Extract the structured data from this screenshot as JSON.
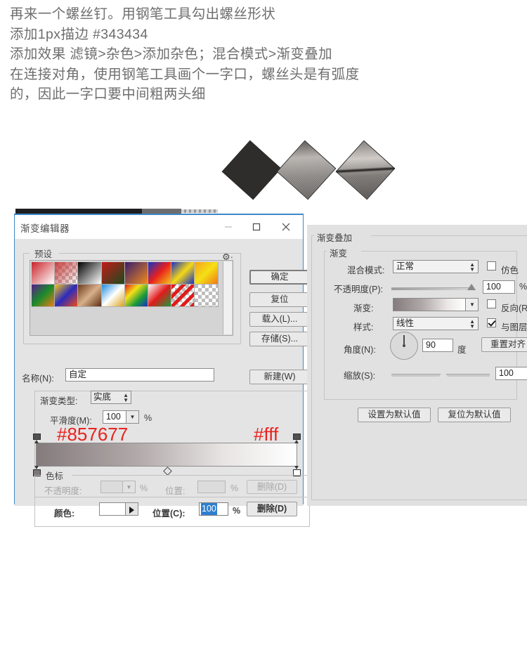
{
  "instructions": {
    "lines": [
      "再来一个螺丝钉。用钢笔工具勾出螺丝形状",
      "添加1px描边 #343434",
      "添加效果  滤镜>杂色>添加杂色；混合模式>渐变叠加",
      "在连接对角，使用钢笔工具画个一字口，螺丝头是有弧度",
      "的，因此一字口要中间粗两头细"
    ]
  },
  "shapes": {
    "shape1_name": "screw-head-dark",
    "shape2_name": "screw-head-gradient",
    "shape3_name": "screw-head-slotted"
  },
  "gradient_editor": {
    "title": "渐变编辑器",
    "window_buttons": {
      "minimize": "minimize-icon",
      "maximize": "maximize-icon",
      "close": "close-icon"
    },
    "presets": {
      "legend": "预设",
      "gear_icon": "gear-icon",
      "swatches": [
        "linear-gradient(135deg,#c9232a,#ffffff)",
        "linear-gradient(135deg,#c7403f,rgba(255,255,255,0))",
        "linear-gradient(135deg,#000000,#ffffff)",
        "linear-gradient(135deg,#c31b1b,#1c4a1c)",
        "linear-gradient(135deg,#3a1d6e,#f08a1a)",
        "linear-gradient(135deg,#1531c4,#e8201c,#f5c518)",
        "linear-gradient(135deg,#1531c4,#f5d816,#1531c4)",
        "linear-gradient(135deg,#f5a21a,#f5e016,#ef7a16)",
        "linear-gradient(135deg,#5b1b8c,#1a8c2a,#ef7a16)",
        "linear-gradient(135deg,#f5c518,#2b2bbd,#ef4a16)",
        "linear-gradient(135deg,#6b3a1c,#d8b08a,#5a2e14)",
        "linear-gradient(135deg,#1b8ce0,#ffffff,#d8a11a)",
        "linear-gradient(135deg,#e01b1b,#f5e016,#1a9b3a,#1531c4)",
        "linear-gradient(135deg,#ffffff,#e01b1b,#1a9b3a)",
        "linear-gradient(135deg,#e01b1b,#ffffff)",
        "transparent-checker"
      ]
    },
    "buttons": {
      "ok": "确定",
      "reset": "复位",
      "load": "载入(L)...",
      "save": "存储(S)...",
      "new": "新建(W)"
    },
    "name_label": "名称(N):",
    "name_value": "自定",
    "gradient_type_label": "渐变类型:",
    "gradient_type_value": "实底",
    "smoothness_label": "平滑度(M):",
    "smoothness_value": "100",
    "smoothness_unit": "%",
    "annotation_left": "#857677",
    "annotation_right": "#fff",
    "annotation_color": "#e8231f",
    "gradient_css": "linear-gradient(to right,#847b7c 0%,#b1a8a8 38%,#e7e4e3 72%,#ffffff 100%)",
    "stops": {
      "legend": "色标",
      "opacity_label": "不透明度:",
      "opacity_value": "",
      "opacity_unit": "%",
      "position_label_1": "位置:",
      "position_value_1": "",
      "position_unit_1": "%",
      "delete_label_1": "删除(D)",
      "color_label": "颜色:",
      "color_value": "#ffffff",
      "position_label_2": "位置(C):",
      "position_value_2": "100",
      "position_unit_2": "%",
      "delete_label_2": "删除(D)"
    }
  },
  "gradient_overlay": {
    "title": "渐变叠加",
    "subtitle": "渐变",
    "blend_mode_label": "混合模式:",
    "blend_mode_value": "正常",
    "dither_label": "仿色",
    "dither_checked": false,
    "opacity_label": "不透明度(P):",
    "opacity_value": "100",
    "opacity_unit": "%",
    "gradient_label": "渐变:",
    "gradient_css": "linear-gradient(to right,#847b7c 0%,#b1a8a8 40%,#eae7e6 75%,#ffffff 100%)",
    "reverse_label": "反向(R)",
    "reverse_checked": false,
    "style_label": "样式:",
    "style_value": "线性",
    "align_label": "与图层对齐",
    "align_checked": true,
    "angle_label": "角度(N):",
    "angle_value": "90",
    "angle_unit": "度",
    "realign_label": "重置对齐",
    "scale_label": "缩放(S):",
    "scale_value": "100",
    "scale_unit": "%",
    "set_default_label": "设置为默认值",
    "reset_default_label": "复位为默认值"
  },
  "watermark": ""
}
